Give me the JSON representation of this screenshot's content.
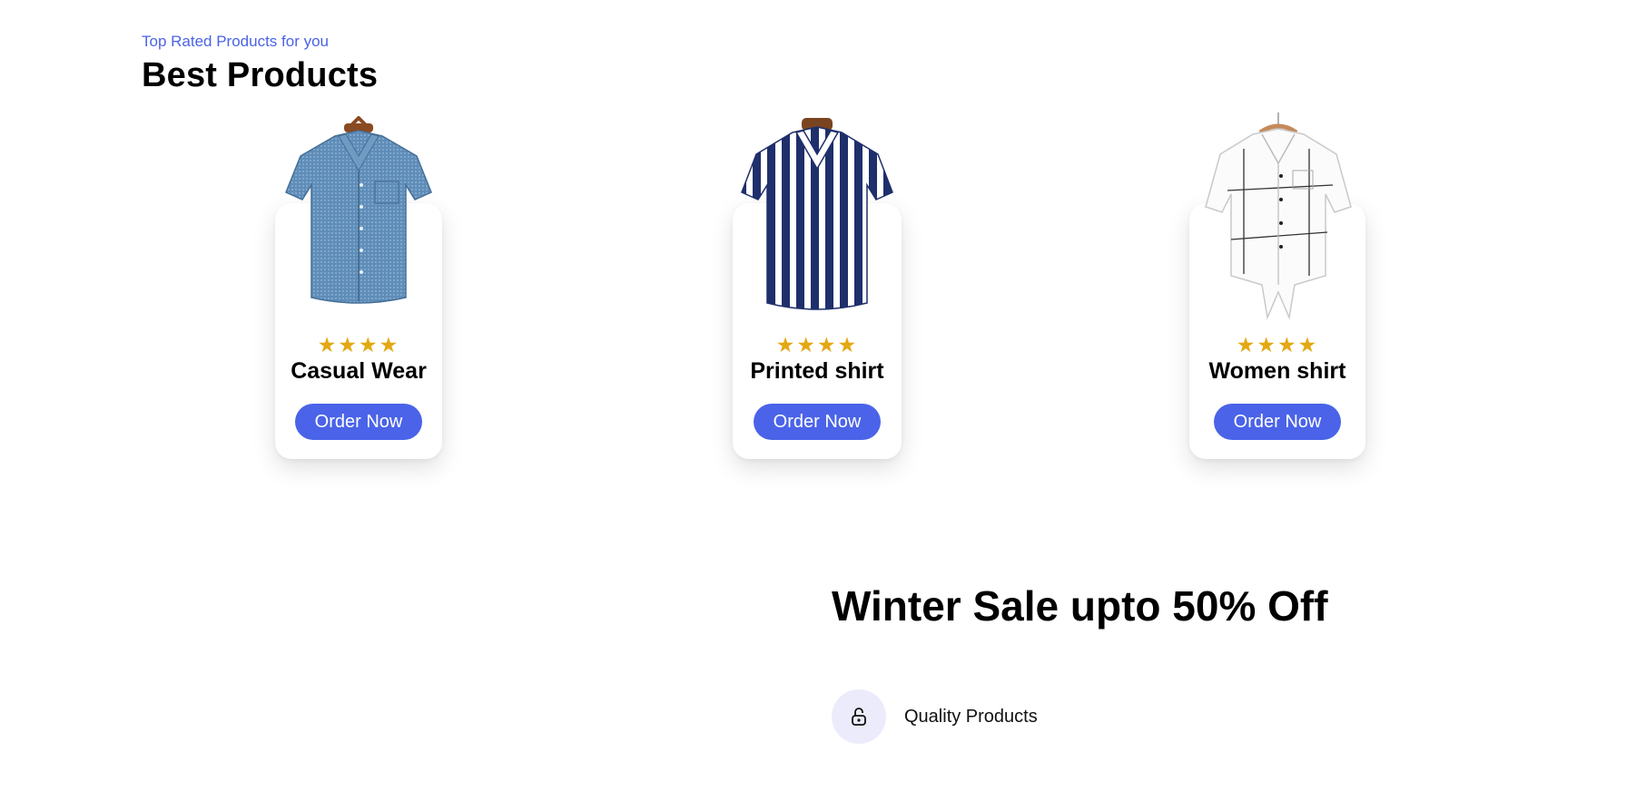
{
  "section": {
    "subtitle": "Top Rated Products for you",
    "title": "Best Products"
  },
  "products": [
    {
      "name": "Casual Wear",
      "stars": "★★★★",
      "rating": 4,
      "button": "Order Now",
      "image_icon": "blue-checked-shirt-image"
    },
    {
      "name": "Printed shirt",
      "stars": "★★★★",
      "rating": 4,
      "button": "Order Now",
      "image_icon": "navy-striped-shirt-image"
    },
    {
      "name": "Women shirt",
      "stars": "★★★★",
      "rating": 4,
      "button": "Order Now",
      "image_icon": "white-plaid-shirt-image"
    }
  ],
  "sale": {
    "title": "Winter Sale upto 50% Off",
    "features": [
      {
        "label": "Quality Products",
        "icon": "lock-icon"
      }
    ]
  },
  "colors": {
    "accent": "#4a63e8",
    "star": "#e3a812",
    "feature_icon_bg": "#ecebfb"
  }
}
